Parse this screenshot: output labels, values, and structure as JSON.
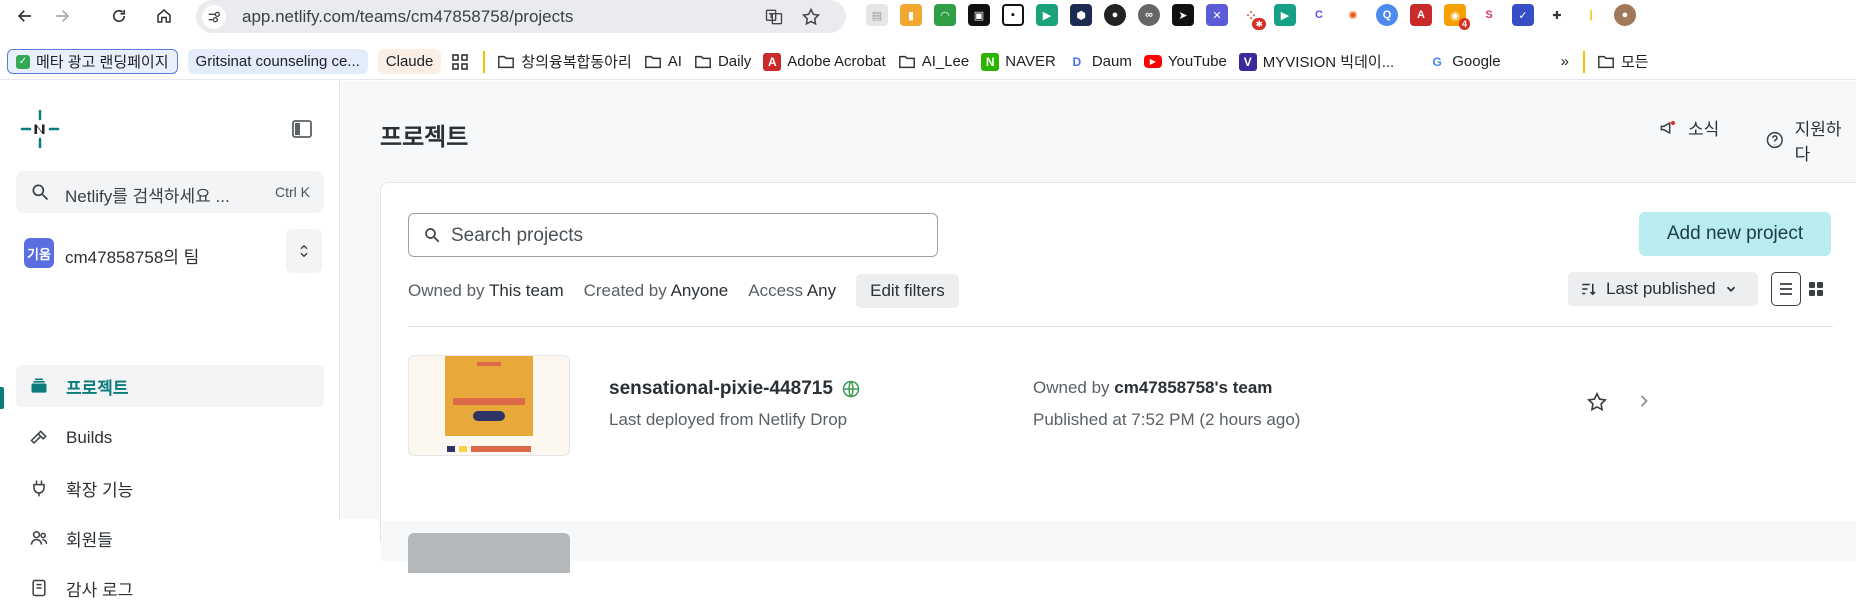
{
  "browser": {
    "url": "app.netlify.com/teams/cm47858758/projects",
    "bookmarks": [
      {
        "label": "메타 광고 랜딩페이지",
        "style": "pill-blue"
      },
      {
        "label": "Gritsinat counseling ce...",
        "style": "pill-lightblue"
      },
      {
        "label": "Claude",
        "style": "pill-peach"
      },
      {
        "label": "",
        "icon": "apps-grid-icon"
      },
      {
        "label": "창의융복합동아리",
        "icon": "folder-icon"
      },
      {
        "label": "AI",
        "icon": "folder-icon"
      },
      {
        "label": "Daily",
        "icon": "folder-icon"
      },
      {
        "label": "Adobe Acrobat",
        "icon": "acrobat-icon"
      },
      {
        "label": "AI_Lee",
        "icon": "folder-icon"
      },
      {
        "label": "NAVER",
        "icon": "naver-icon"
      },
      {
        "label": "Daum",
        "icon": "daum-icon"
      },
      {
        "label": "YouTube",
        "icon": "youtube-icon"
      },
      {
        "label": "MYVISION 빅데이...",
        "icon": "myvision-icon"
      },
      {
        "label": "Google",
        "icon": "google-icon"
      },
      {
        "label": "»",
        "icon": "more-bookmarks-icon"
      },
      {
        "label": "모든",
        "icon": "folder-icon"
      }
    ],
    "extension_badge": "4"
  },
  "sidebar": {
    "search_placeholder": "Netlify를 검색하세요 ...",
    "search_shortcut": "Ctrl K",
    "team_avatar": "기움",
    "team_name": "cm47858758의 팀",
    "nav": [
      {
        "label": "프로젝트",
        "icon": "projects-stack-icon",
        "active": true
      },
      {
        "label": "Builds",
        "icon": "hammer-icon",
        "active": false
      },
      {
        "label": "확장 기능",
        "icon": "plug-icon",
        "active": false
      },
      {
        "label": "회원들",
        "icon": "members-icon",
        "active": false
      },
      {
        "label": "감사 로그",
        "icon": "audit-log-icon",
        "active": false
      }
    ]
  },
  "main": {
    "title": "프로젝트",
    "news_label": "소식",
    "support_label": "지원하다",
    "search_placeholder": "Search projects",
    "add_button": "Add new project",
    "filters": [
      {
        "key": "Owned by",
        "value": "This team"
      },
      {
        "key": "Created by",
        "value": "Anyone"
      },
      {
        "key": "Access",
        "value": "Any"
      }
    ],
    "edit_filters": "Edit filters",
    "sort_label": "Last published",
    "projects": [
      {
        "name": "sensational-pixie-448715",
        "subtitle": "Last deployed from Netlify Drop",
        "owned_prefix": "Owned by",
        "owner": "cm47858758's team",
        "published": "Published at 7:52 PM (2 hours ago)"
      }
    ]
  },
  "colors": {
    "accent": "#097c7b",
    "add_button_bg": "#b8ecee",
    "thumb_orange": "#e8a83a",
    "thumb_red": "#dc6a4a",
    "thumb_navy": "#2e3466"
  }
}
